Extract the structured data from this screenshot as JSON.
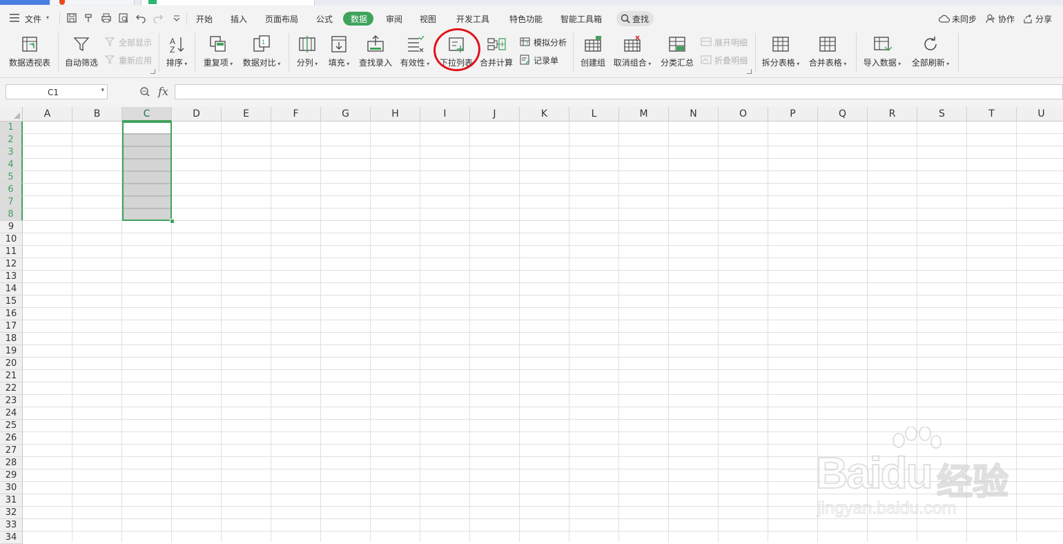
{
  "menubar": {
    "file_label": "文件",
    "tabs": [
      {
        "id": "home",
        "label": "开始"
      },
      {
        "id": "insert",
        "label": "插入"
      },
      {
        "id": "layout",
        "label": "页面布局"
      },
      {
        "id": "formula",
        "label": "公式"
      },
      {
        "id": "data",
        "label": "数据",
        "active": true
      },
      {
        "id": "review",
        "label": "审阅"
      },
      {
        "id": "view",
        "label": "视图"
      },
      {
        "id": "developer",
        "label": "开发工具"
      },
      {
        "id": "special",
        "label": "特色功能"
      },
      {
        "id": "smart",
        "label": "智能工具箱"
      }
    ],
    "search_label": "查找",
    "sync_label": "未同步",
    "collab_label": "协作",
    "share_label": "分享"
  },
  "ribbon": {
    "pivot": "数据透视表",
    "autofilter": "自动筛选",
    "show_all": "全部显示",
    "reapply": "重新应用",
    "sort": "排序",
    "duplicates": "重复项",
    "compare": "数据对比",
    "split_col": "分列",
    "fill": "填充",
    "lookup_entry": "查找录入",
    "validity": "有效性",
    "dropdown_list": "下拉列表",
    "consolidate": "合并计算",
    "what_if": "模拟分析",
    "record_form": "记录单",
    "create_group": "创建组",
    "ungroup": "取消组合",
    "subtotal": "分类汇总",
    "show_detail": "展开明细",
    "hide_detail": "折叠明细",
    "split_table": "拆分表格",
    "merge_table": "合并表格",
    "import_data": "导入数据",
    "refresh_all": "全部刷新"
  },
  "formula_bar": {
    "name_box": "C1",
    "fx_label": "fx",
    "formula": ""
  },
  "sheet": {
    "columns": [
      "A",
      "B",
      "C",
      "D",
      "E",
      "F",
      "G",
      "H",
      "I",
      "J",
      "K",
      "L",
      "M",
      "N",
      "O",
      "P",
      "Q",
      "R",
      "S",
      "T",
      "U"
    ],
    "rows": [
      "1",
      "2",
      "3",
      "4",
      "5",
      "6",
      "7",
      "8",
      "9",
      "10",
      "11",
      "12",
      "13",
      "14",
      "15",
      "16",
      "17",
      "18",
      "19",
      "20",
      "21",
      "22",
      "23",
      "24",
      "25",
      "26",
      "27",
      "28",
      "29",
      "30",
      "31",
      "32",
      "33",
      "34"
    ],
    "selected_column": "C",
    "selected_rows": [
      "1",
      "2",
      "3",
      "4",
      "5",
      "6",
      "7",
      "8"
    ],
    "selection_range": "C1:C8"
  },
  "watermark": {
    "brand": "Baidu",
    "brand_cn": "经验",
    "url": "jingyan.baidu.com"
  },
  "colors": {
    "accent": "#3fa35b",
    "highlight_ring": "#e0111b",
    "toolbar_bg": "#f3f3f3"
  }
}
